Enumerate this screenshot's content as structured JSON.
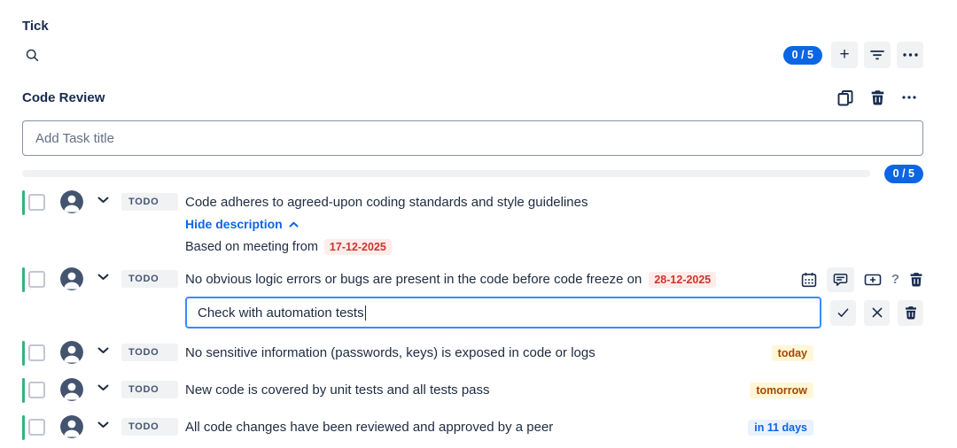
{
  "app": {
    "title": "Tick"
  },
  "toolbar": {
    "progress_badge": "0 / 5",
    "add_label": "+"
  },
  "checklist": {
    "title": "Code Review",
    "add_task_placeholder": "Add Task title",
    "progress_badge": "0 / 5"
  },
  "tasks": [
    {
      "status": "TODO",
      "title": "Code adheres to agreed-upon coding standards and style guidelines",
      "description_toggle": "Hide description",
      "description_text": "Based on meeting from",
      "description_date": "17-12-2025"
    },
    {
      "status": "TODO",
      "title": "No obvious logic errors or bugs are present in the code before code freeze on",
      "due_date": "28-12-2025",
      "edit_value": "Check with automation tests",
      "help_label": "?"
    },
    {
      "status": "TODO",
      "title": "No sensitive information (passwords, keys) is exposed in code or logs",
      "due_label": "today"
    },
    {
      "status": "TODO",
      "title": "New code is covered by unit tests and all tests pass",
      "due_label": "tomorrow"
    },
    {
      "status": "TODO",
      "title": "All code changes have been reviewed and approved by a peer",
      "due_label": "in 11 days"
    }
  ],
  "icons": {
    "search": "magnifier",
    "add": "plus",
    "filter": "filter-lines",
    "more": "ellipsis",
    "copy": "copy-pages",
    "trash": "trash-can",
    "calendar": "calendar-grid",
    "comment": "speech-bubble",
    "convert": "card-plus",
    "help": "question-mark",
    "confirm": "check-mark",
    "cancel": "x-mark",
    "expand": "chevron-down",
    "collapse": "chevron-up",
    "assignee": "person-avatar",
    "checkbox": "unchecked-square"
  },
  "colors": {
    "accent_blue": "#0C66E4",
    "focus_blue": "#388BFF",
    "green_status_bar": "#36B37E",
    "avatar_gray": "#44546F",
    "badge_gray_bg": "#F1F2F4",
    "red_badge_bg": "#FFECEB",
    "red_badge_text": "#C9372C",
    "orange_badge_bg": "#FFF7D6",
    "orange_badge_text": "#A54800",
    "blue_badge_bg": "#E9F2FF",
    "blue_badge_text": "#0C66E4"
  }
}
